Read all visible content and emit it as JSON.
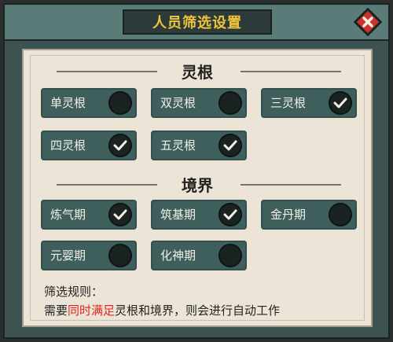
{
  "dialog": {
    "title": "人员筛选设置",
    "close_icon": "close-x-icon"
  },
  "spirit_root": {
    "heading": "灵根",
    "options": [
      {
        "label": "单灵根",
        "checked": false
      },
      {
        "label": "双灵根",
        "checked": false
      },
      {
        "label": "三灵根",
        "checked": true
      },
      {
        "label": "四灵根",
        "checked": true
      },
      {
        "label": "五灵根",
        "checked": true
      }
    ]
  },
  "realm": {
    "heading": "境界",
    "options": [
      {
        "label": "炼气期",
        "checked": true
      },
      {
        "label": "筑基期",
        "checked": true
      },
      {
        "label": "金丹期",
        "checked": false
      },
      {
        "label": "元婴期",
        "checked": false
      },
      {
        "label": "化神期",
        "checked": false
      }
    ]
  },
  "rules": {
    "title": "筛选规则：",
    "prefix": "需要",
    "highlight": "同时满足",
    "suffix": "灵根和境界，则会进行自动工作"
  },
  "colors": {
    "highlight": "#e0261b",
    "title_text": "#f0c43c",
    "chip_bg": "#3f5f5d"
  }
}
